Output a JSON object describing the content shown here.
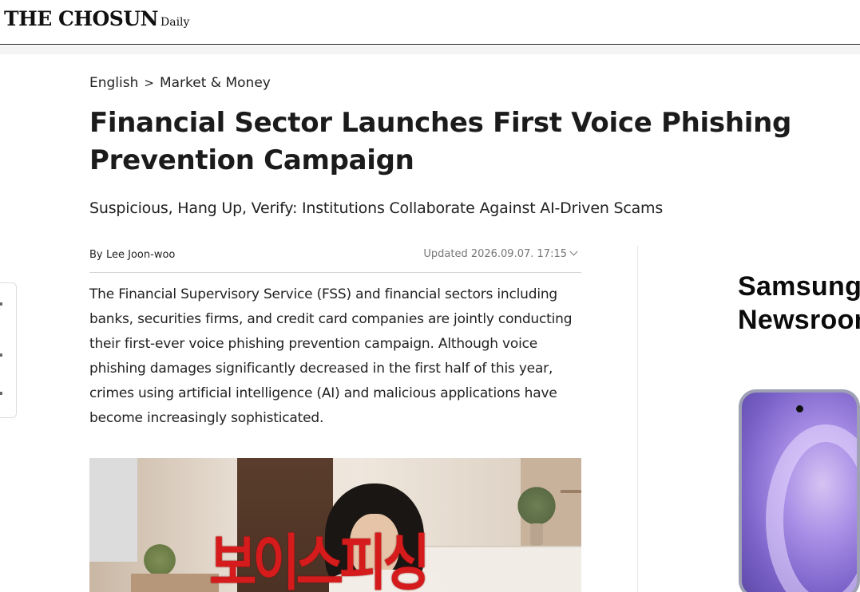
{
  "site": {
    "logo": "THE CHOSUN",
    "logo_sub": "Daily"
  },
  "breadcrumb": {
    "root": "English",
    "separator": ">",
    "section": "Market & Money"
  },
  "article": {
    "headline": "Financial Sector Launches First Voice Phishing Prevention Campaign",
    "subheadline": "Suspicious, Hang Up, Verify: Institutions Collaborate Against AI-Driven Scams",
    "by_prefix": "By",
    "author": "Lee Joon-woo",
    "updated": "Updated 2026.09.07. 17:15",
    "body": "The Financial Supervisory Service (FSS) and financial sectors including banks, securities firms, and credit card companies are jointly conducting their first-ever voice phishing prevention campaign. Although voice phishing damages significantly decreased in the first half of this year, crimes using artificial intelligence (AI) and malicious applications have become increasingly sophisticated.",
    "image_overlay_text": "보이스피싱"
  },
  "ad": {
    "brand_line1": "Samsung",
    "brand_line2": "Newsroom"
  },
  "colors": {
    "overlay_red": "#d51b1b",
    "text": "#111111",
    "muted": "#777777"
  }
}
